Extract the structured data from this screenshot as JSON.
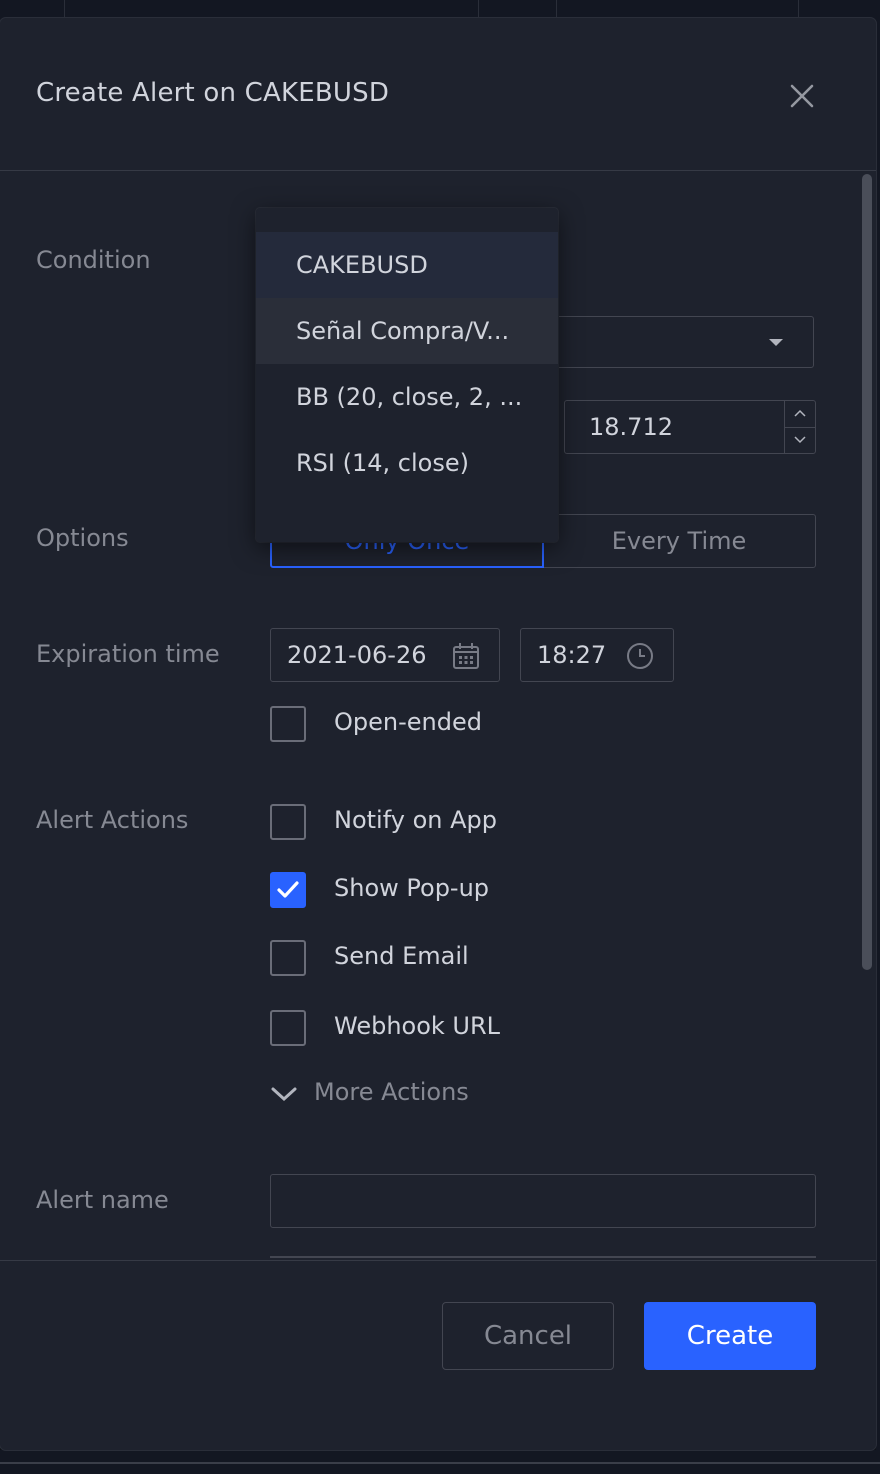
{
  "dialog": {
    "title": "Create Alert on CAKEBUSD"
  },
  "condition": {
    "label": "Condition",
    "value": "18.712",
    "dropdown_options": [
      "CAKEBUSD",
      "Señal Compra/V...",
      "BB (20, close, 2, ...",
      "RSI (14, close)"
    ],
    "selected_option": "CAKEBUSD",
    "hovered_option": "Señal Compra/V..."
  },
  "options": {
    "label": "Options",
    "only_once": "Only Once",
    "every_time": "Every Time",
    "active": "Only Once"
  },
  "expiration": {
    "label": "Expiration time",
    "date": "2021-06-26",
    "time": "18:27",
    "open_ended_label": "Open-ended",
    "open_ended": false
  },
  "alert_actions": {
    "label": "Alert Actions",
    "items": [
      {
        "label": "Notify on App",
        "checked": false
      },
      {
        "label": "Show Pop-up",
        "checked": true
      },
      {
        "label": "Send Email",
        "checked": false
      },
      {
        "label": "Webhook URL",
        "checked": false
      }
    ],
    "more_actions": "More Actions"
  },
  "alert_name": {
    "label": "Alert name",
    "value": "",
    "placeholder": ""
  },
  "buttons": {
    "cancel": "Cancel",
    "create": "Create"
  },
  "colors": {
    "background": "#1e222d",
    "accent": "#2962ff",
    "text": "#d1d4dc",
    "muted": "#868993",
    "border": "#434651"
  },
  "icons": {
    "close": "close-icon",
    "calendar": "calendar-icon",
    "clock": "clock-icon",
    "dropdown": "chevron-down-icon",
    "check": "checkmark-icon"
  }
}
